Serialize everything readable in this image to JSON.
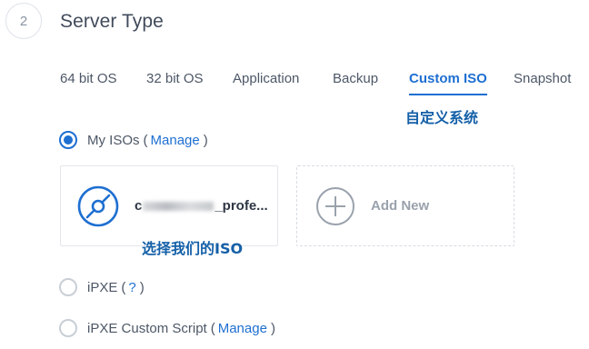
{
  "step": {
    "number": "2",
    "title": "Server Type"
  },
  "tabs": [
    {
      "label": "64 bit OS",
      "active": false
    },
    {
      "label": "32 bit OS",
      "active": false
    },
    {
      "label": "Application",
      "active": false
    },
    {
      "label": "Backup",
      "active": false
    },
    {
      "label": "Custom ISO",
      "active": true
    },
    {
      "label": "Snapshot",
      "active": false
    }
  ],
  "annotations": {
    "custom_iso_note": "自定义系统",
    "select_iso_note": "选择我们的ISO"
  },
  "options": {
    "my_isos": {
      "label": "My ISOs",
      "open": "(",
      "link": "Manage",
      "close": ")",
      "checked": true
    },
    "ipxe": {
      "label": "iPXE",
      "open": "(",
      "link": "?",
      "close": ")",
      "checked": false
    },
    "ipxe_script": {
      "label": "iPXE Custom Script",
      "open": "(",
      "link": "Manage",
      "close": ")",
      "checked": false
    }
  },
  "iso_card": {
    "name_prefix": "c",
    "name_suffix": "_profe...",
    "icon": "disc-icon"
  },
  "add_card": {
    "label": "Add New",
    "icon": "plus-circle-icon"
  },
  "colors": {
    "accent": "#1e6fd1",
    "annotation": "#1560a8",
    "text": "#4d5767"
  }
}
